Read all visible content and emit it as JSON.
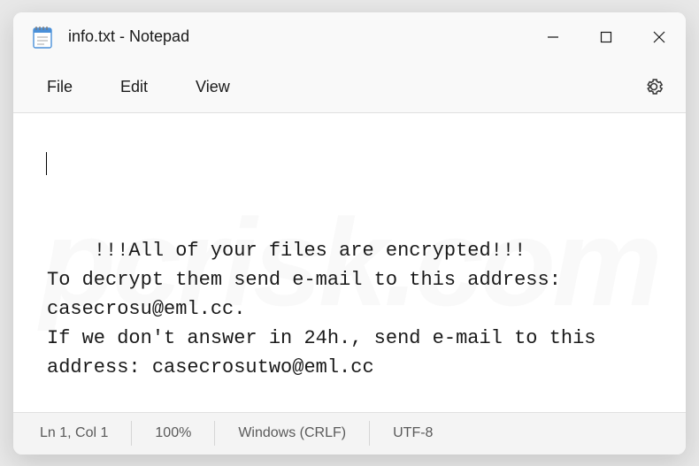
{
  "titlebar": {
    "title": "info.txt - Notepad"
  },
  "menubar": {
    "file": "File",
    "edit": "Edit",
    "view": "View"
  },
  "editor": {
    "content": "!!!All of your files are encrypted!!!\nTo decrypt them send e-mail to this address: casecrosu@eml.cc.\nIf we don't answer in 24h., send e-mail to this address: casecrosutwo@eml.cc"
  },
  "statusbar": {
    "position": "Ln 1, Col 1",
    "zoom": "100%",
    "lineending": "Windows (CRLF)",
    "encoding": "UTF-8"
  },
  "watermark": "pcrisk.com"
}
